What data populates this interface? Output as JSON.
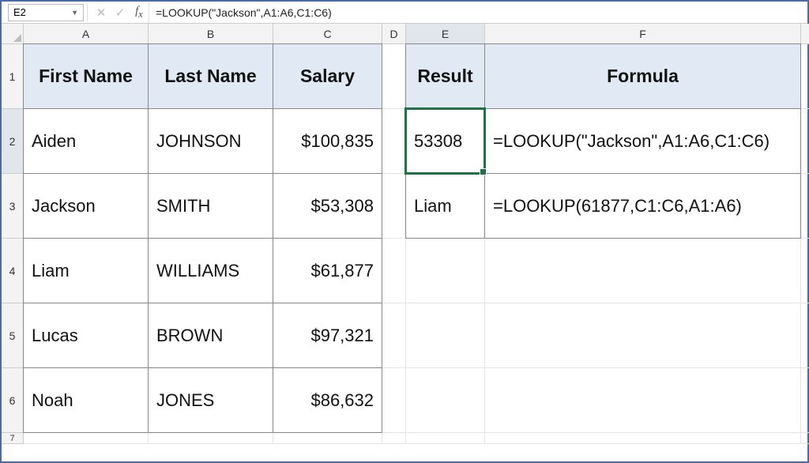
{
  "nameBox": "E2",
  "formulaBar": "=LOOKUP(\"Jackson\",A1:A6,C1:C6)",
  "columns": [
    "A",
    "B",
    "C",
    "D",
    "E",
    "F",
    ""
  ],
  "rows": [
    "1",
    "2",
    "3",
    "4",
    "5",
    "6",
    "7"
  ],
  "headers": {
    "firstName": "First Name",
    "lastName": "Last Name",
    "salary": "Salary",
    "result": "Result",
    "formula": "Formula"
  },
  "tableA": [
    {
      "first": "Aiden",
      "last": "JOHNSON",
      "salary": "$100,835"
    },
    {
      "first": "Jackson",
      "last": "SMITH",
      "salary": "$53,308"
    },
    {
      "first": "Liam",
      "last": "WILLIAMS",
      "salary": "$61,877"
    },
    {
      "first": "Lucas",
      "last": "BROWN",
      "salary": "$97,321"
    },
    {
      "first": "Noah",
      "last": "JONES",
      "salary": "$86,632"
    }
  ],
  "tableB": [
    {
      "result": "53308",
      "formula": "=LOOKUP(\"Jackson\",A1:A6,C1:C6)"
    },
    {
      "result": "Liam",
      "formula": "=LOOKUP(61877,C1:C6,A1:A6)"
    }
  ],
  "activeCell": "E2"
}
